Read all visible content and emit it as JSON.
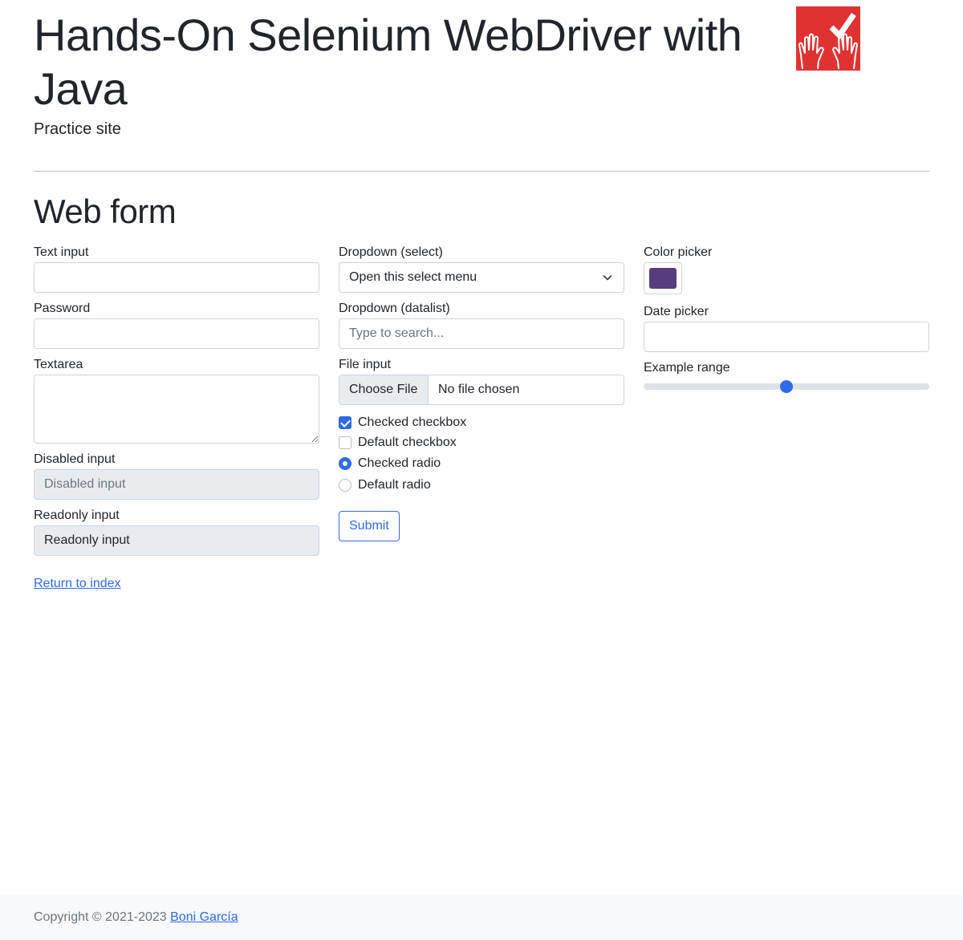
{
  "header": {
    "title": "Hands-On Selenium WebDriver with Java",
    "subtitle": "Practice site",
    "logo_icon": "hands-checkmark-logo",
    "logo_color": "#e13232"
  },
  "form": {
    "title": "Web form",
    "text_input": {
      "label": "Text input",
      "value": ""
    },
    "password": {
      "label": "Password",
      "value": ""
    },
    "textarea": {
      "label": "Textarea",
      "value": ""
    },
    "disabled_input": {
      "label": "Disabled input",
      "placeholder": "Disabled input"
    },
    "readonly_input": {
      "label": "Readonly input",
      "value": "Readonly input"
    },
    "dropdown_select": {
      "label": "Dropdown (select)",
      "selected": "Open this select menu"
    },
    "dropdown_datalist": {
      "label": "Dropdown (datalist)",
      "placeholder": "Type to search..."
    },
    "file_input": {
      "label": "File input",
      "button": "Choose File",
      "status": "No file chosen"
    },
    "checkboxes": [
      {
        "label": "Checked checkbox",
        "checked": true
      },
      {
        "label": "Default checkbox",
        "checked": false
      }
    ],
    "radios": [
      {
        "label": "Checked radio",
        "checked": true
      },
      {
        "label": "Default radio",
        "checked": false
      }
    ],
    "submit_label": "Submit",
    "color_picker": {
      "label": "Color picker",
      "value": "#563d7c"
    },
    "date_picker": {
      "label": "Date picker",
      "value": ""
    },
    "range": {
      "label": "Example range",
      "value": 50,
      "min": 0,
      "max": 100
    }
  },
  "return_link": "Return to index",
  "footer": {
    "copyright": "Copyright © 2021-2023",
    "author": "Boni García"
  },
  "colors": {
    "accent": "#2f6ae8",
    "muted": "#6c757d",
    "disabled_bg": "#e9ecef"
  }
}
